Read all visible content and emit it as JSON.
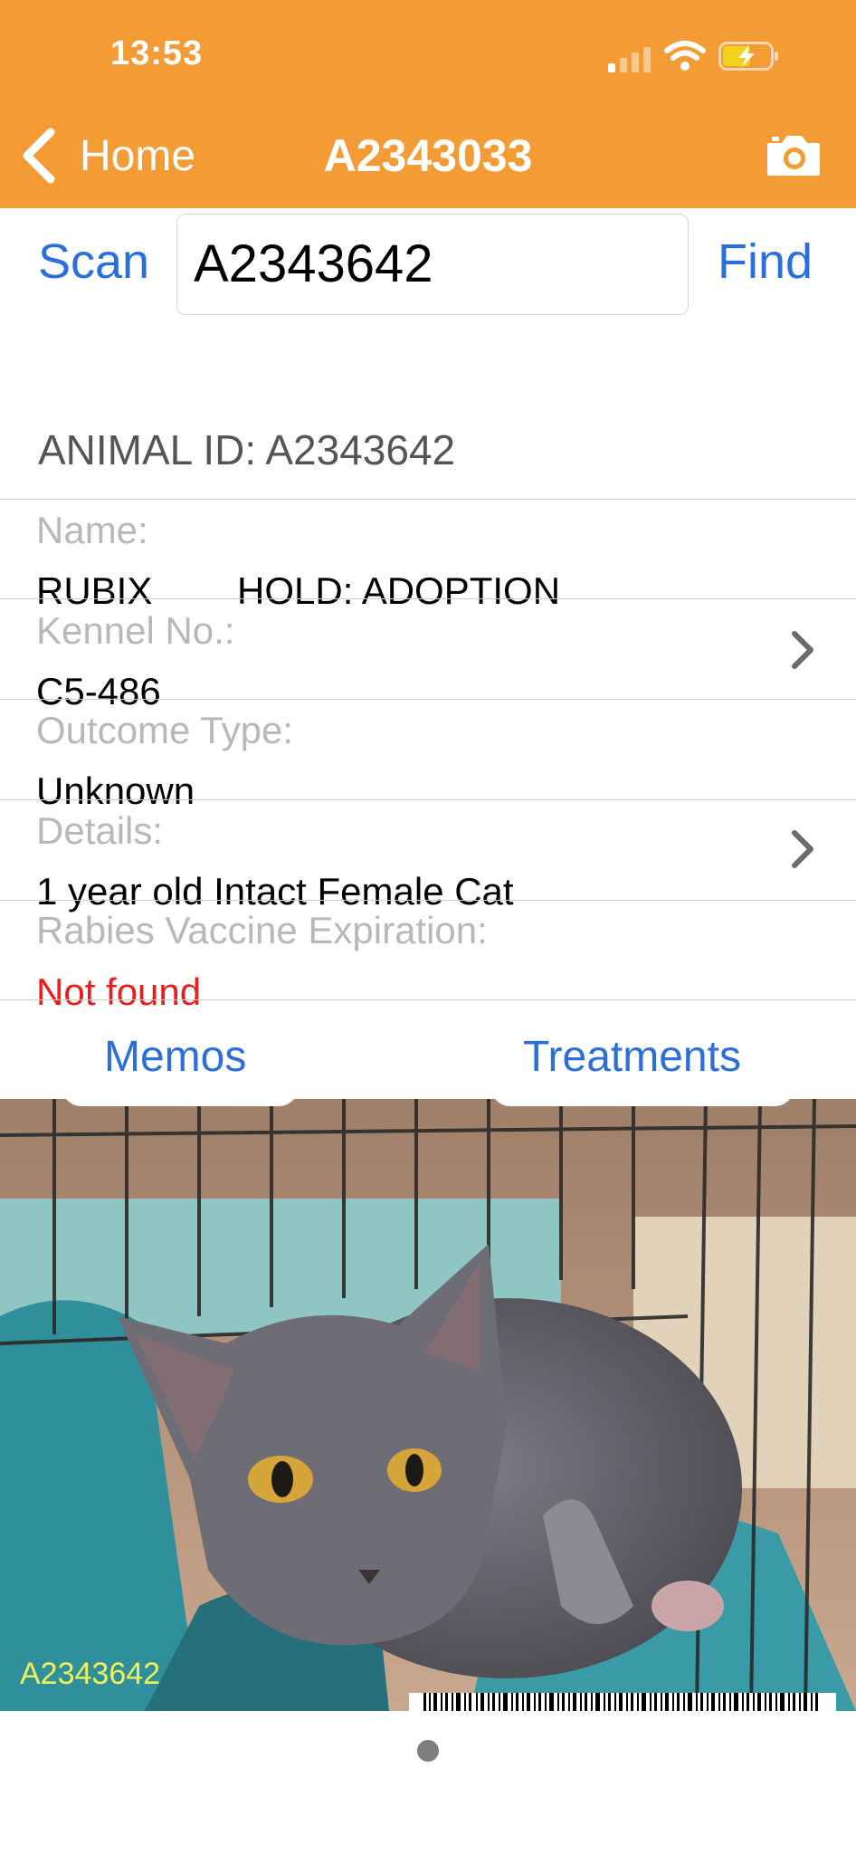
{
  "status_bar": {
    "time": "13:53",
    "icons": [
      "signal-icon",
      "wifi-icon",
      "battery-charging-icon"
    ]
  },
  "nav": {
    "back_label": "Home",
    "title": "A2343033",
    "camera_icon": "camera-icon"
  },
  "search": {
    "scan_label": "Scan",
    "value": "A2343642",
    "find_label": "Find"
  },
  "animal": {
    "id_line": "ANIMAL ID: A2343642",
    "fields": [
      {
        "label": "Name:",
        "value": "RUBIX",
        "extra": "HOLD: ADOPTION"
      },
      {
        "label": "Kennel No.:",
        "value": "C5-486"
      },
      {
        "label": "Outcome Type:",
        "value": "Unknown"
      },
      {
        "label": "Details:",
        "value": "1 year old Intact Female Cat"
      },
      {
        "label": "Rabies Vaccine Expiration:",
        "value": "Not found"
      }
    ]
  },
  "tabs": {
    "memos": "Memos",
    "treatments": "Treatments"
  },
  "photo": {
    "id_label": "A2343642"
  },
  "colors": {
    "header": "#f39c36",
    "link": "#2a6fdb",
    "alert": "#ea1d1d",
    "label_gray": "#b8b8b8"
  }
}
